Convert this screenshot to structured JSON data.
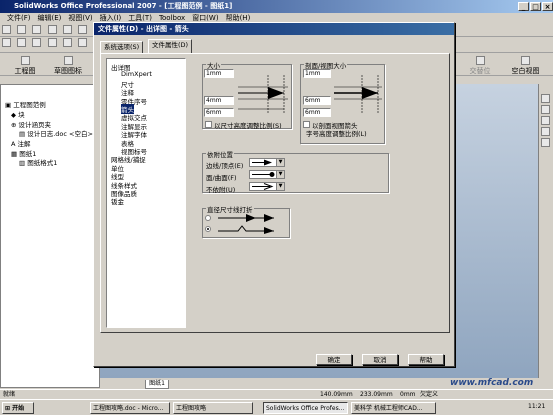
{
  "app": {
    "title": "SolidWorks Office Professional 2007 - [工程图范例 - 图纸1]"
  },
  "menu": [
    "文件(F)",
    "编辑(E)",
    "视图(V)",
    "插入(I)",
    "工具(T)",
    "Toolbox",
    "窗口(W)",
    "帮助(H)"
  ],
  "toolbar": {
    "drawing_label": "工程图",
    "annotation_label": "草图图标",
    "blank_view_label": "空白视图",
    "layout_label": "交替位"
  },
  "feature_tree": {
    "items": [
      "工程图范例",
      "块",
      "设计涵页夹",
      "设计日志.doc <空白>",
      "注解",
      "图纸1",
      "图纸格式1"
    ]
  },
  "dialog": {
    "title": "文件属性(D) - 出详图 - 箭头",
    "tabs": [
      "系统选项(S)",
      "文件属性(D)"
    ],
    "tree": [
      "出详图",
      "DimXpert",
      "尺寸",
      "注释",
      "零件序号",
      "箭头",
      "虚拟交点",
      "注解显示",
      "注解字体",
      "表格",
      "视图标号",
      "网格线/捕捉",
      "单位",
      "线型",
      "线条样式",
      "图像品质",
      "钣金"
    ],
    "size_group": {
      "label": "大小",
      "values": [
        "1mm",
        "4mm",
        "6mm"
      ],
      "scale_checkbox": "以尺寸高度调整比例(S)"
    },
    "section_group": {
      "label": "剖面/视图大小",
      "values": [
        "1mm",
        "6mm",
        "6mm"
      ],
      "scale_checkbox_line1": "以剖面视图箭头",
      "scale_checkbox_line2": "字号高度调整比例(L)"
    },
    "attach_group": {
      "label": "依附位置",
      "rows": [
        "边线/顶点(E)",
        "面/曲面(F)",
        "不依附(U)"
      ]
    },
    "break_group": {
      "label": "直径尺寸线打折"
    },
    "buttons": {
      "ok": "确定",
      "cancel": "取消",
      "help": "帮助"
    }
  },
  "sheet_tab": "图纸1",
  "status": {
    "left": "就绪",
    "x": "140.09mm",
    "y": "233.09mm",
    "z": "0mm",
    "state": "欠定义"
  },
  "taskbar": {
    "start": "开始",
    "tasks": [
      "工程图攻略.doc - Micro...",
      "工程图攻略",
      "SolidWorks Office Profes...",
      "美科学 机械工程师CAD..."
    ],
    "clock": "11:21"
  },
  "watermark": "www.mfcad.com"
}
